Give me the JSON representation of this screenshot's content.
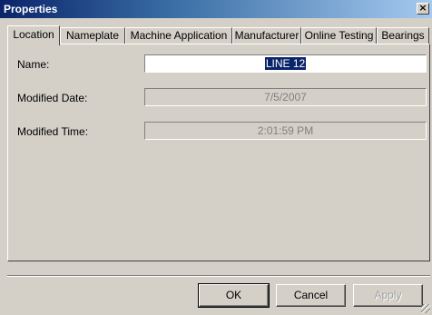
{
  "window": {
    "title": "Properties",
    "close_glyph": "×"
  },
  "tabs": [
    {
      "label": "Location",
      "active": true
    },
    {
      "label": "Nameplate",
      "active": false
    },
    {
      "label": "Machine Application",
      "active": false
    },
    {
      "label": "Manufacturer",
      "active": false
    },
    {
      "label": "Online Testing",
      "active": false
    },
    {
      "label": "Bearings",
      "active": false
    }
  ],
  "fields": {
    "name": {
      "label": "Name:",
      "value": "LINE 12"
    },
    "modified_date": {
      "label": "Modified Date:",
      "value": "7/5/2007"
    },
    "modified_time": {
      "label": "Modified Time:",
      "value": "2:01:59 PM"
    }
  },
  "buttons": {
    "ok": "OK",
    "cancel": "Cancel",
    "apply": "Apply"
  },
  "colors": {
    "titlebar_start": "#0a246a",
    "titlebar_end": "#a6caf0",
    "face": "#d4d0c8",
    "selection": "#0a246a"
  }
}
